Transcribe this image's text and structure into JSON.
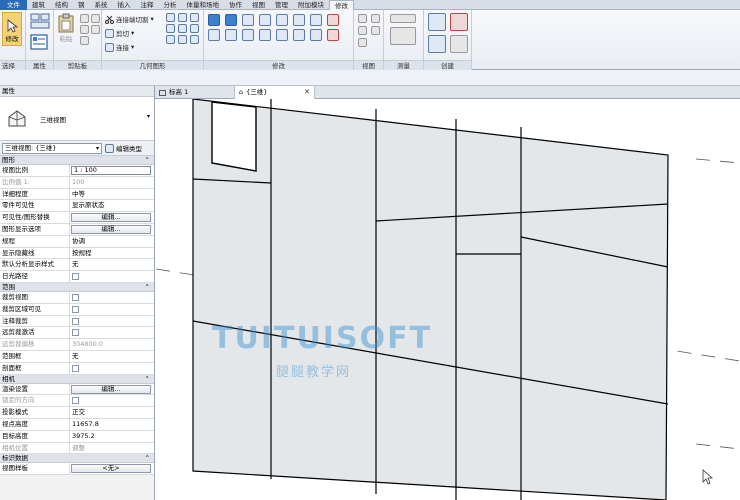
{
  "ribbon_tabs": [
    "文件",
    "建筑",
    "结构",
    "钢",
    "系统",
    "插入",
    "注释",
    "分析",
    "体量和场地",
    "协作",
    "视图",
    "管理",
    "附加模块",
    "修改"
  ],
  "ribbon": {
    "modify_label": "修改",
    "paste_label": "粘贴",
    "cut_join": "连接端切割",
    "cut": "剪切",
    "join": "连接",
    "panels": {
      "select": "选择",
      "properties": "属性",
      "clipboard": "剪贴板",
      "geometry": "几何图形",
      "modify": "修改",
      "view": "视图",
      "measure": "测量",
      "create": "创建"
    }
  },
  "view_tabs": [
    {
      "label": "标高 1",
      "active": false
    },
    {
      "label": "{三维}",
      "active": true
    }
  ],
  "properties": {
    "title": "属性",
    "type_name": "三维视图",
    "selector": "三维视图: {三维}",
    "edit_type": "编辑类型",
    "groups": [
      {
        "name": "图形",
        "rows": [
          {
            "k": "视图比例",
            "v": "1 : 100",
            "kind": "input"
          },
          {
            "k": "比例值 1:",
            "v": "100",
            "kind": "text",
            "grey": true
          },
          {
            "k": "详细程度",
            "v": "中等",
            "kind": "text"
          },
          {
            "k": "零件可见性",
            "v": "显示原状态",
            "kind": "text"
          },
          {
            "k": "可见性/图形替换",
            "v": "编辑...",
            "kind": "button"
          },
          {
            "k": "图形显示选项",
            "v": "编辑...",
            "kind": "button"
          },
          {
            "k": "规程",
            "v": "协调",
            "kind": "text"
          },
          {
            "k": "显示隐藏线",
            "v": "按规程",
            "kind": "text"
          },
          {
            "k": "默认分析显示样式",
            "v": "无",
            "kind": "text"
          },
          {
            "k": "日光路径",
            "v": "",
            "kind": "check"
          }
        ]
      },
      {
        "name": "范围",
        "rows": [
          {
            "k": "裁剪视图",
            "v": "",
            "kind": "check"
          },
          {
            "k": "裁剪区域可见",
            "v": "",
            "kind": "check"
          },
          {
            "k": "注释裁剪",
            "v": "",
            "kind": "check"
          },
          {
            "k": "远剪裁激活",
            "v": "",
            "kind": "check"
          },
          {
            "k": "远剪裁偏移",
            "v": "304800.0",
            "kind": "text",
            "grey": true
          },
          {
            "k": "范围框",
            "v": "无",
            "kind": "text"
          },
          {
            "k": "剖面框",
            "v": "",
            "kind": "check"
          }
        ]
      },
      {
        "name": "相机",
        "rows": [
          {
            "k": "渲染设置",
            "v": "编辑...",
            "kind": "button"
          },
          {
            "k": "锁定的方向",
            "v": "",
            "kind": "check",
            "grey": true
          },
          {
            "k": "投影模式",
            "v": "正交",
            "kind": "text"
          },
          {
            "k": "视点高度",
            "v": "11657.8",
            "kind": "text"
          },
          {
            "k": "目标高度",
            "v": "3975.2",
            "kind": "text"
          },
          {
            "k": "相机位置",
            "v": "调整",
            "kind": "text",
            "grey": true
          }
        ]
      },
      {
        "name": "标识数据",
        "rows": [
          {
            "k": "视图样板",
            "v": "<无>",
            "kind": "button"
          }
        ]
      }
    ]
  },
  "watermark": {
    "title": "TUITUISOFT",
    "subtitle": "腿腿教学网"
  }
}
